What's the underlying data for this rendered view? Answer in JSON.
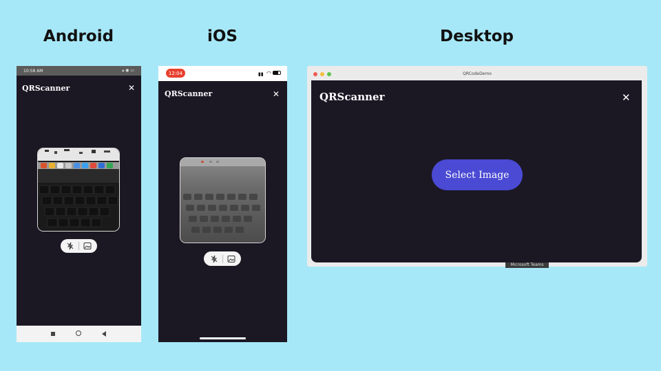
{
  "headings": {
    "android": "Android",
    "ios": "iOS",
    "desktop": "Desktop"
  },
  "android": {
    "status_time": "10:58 AM",
    "app_title": "QRScanner",
    "close_icon": "close-icon",
    "toolbar_icons": [
      "flash-off-icon",
      "image-icon"
    ],
    "nav_icons": [
      "square-icon",
      "circle-icon",
      "triangle-back-icon"
    ]
  },
  "ios": {
    "status_time": "12:04",
    "app_title": "QRScanner",
    "close_icon": "close-icon",
    "toolbar_icons": [
      "flash-off-icon",
      "image-icon"
    ]
  },
  "desktop": {
    "window_title": "QRCodeDemo",
    "app_title": "QRScanner",
    "select_button": "Select Image",
    "tooltip": "Microsoft Teams",
    "colors": {
      "accent": "#4a4ad4",
      "background": "#1b1824"
    }
  }
}
